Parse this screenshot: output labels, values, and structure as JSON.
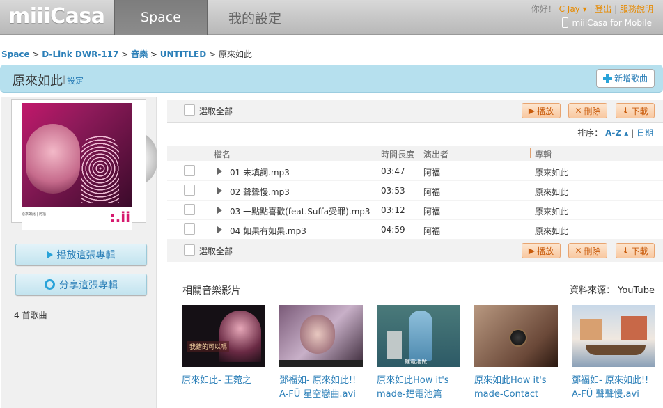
{
  "header": {
    "logo": "miiiCasa",
    "tabs": [
      {
        "label": "Space",
        "active": true
      },
      {
        "label": "我的設定",
        "active": false
      }
    ],
    "greeting": "你好！",
    "user": "C Jay",
    "logout": "登出",
    "help": "服務說明",
    "mobile": "miiiCasa for Mobile"
  },
  "breadcrumb": [
    "Space",
    "D-Link DWR-117",
    "音樂",
    "UNTITLED",
    "原來如此"
  ],
  "album": {
    "title": "原來如此",
    "settings": "設定",
    "new_song": "新增歌曲",
    "play_album": "播放這張專輯",
    "share_album": "分享這張專輯",
    "song_count": "4 首歌曲"
  },
  "toolbar": {
    "select_all": "選取全部",
    "play": "播放",
    "delete": "刪除",
    "download": "下載"
  },
  "sort": {
    "label": "排序：",
    "az": "A-Z",
    "date": "日期"
  },
  "table": {
    "headers": [
      "檔名",
      "時間長度",
      "演出者",
      "專輯"
    ],
    "rows": [
      {
        "file": "01 未填詞.mp3",
        "duration": "03:47",
        "artist": "阿福",
        "album": "原來如此"
      },
      {
        "file": "02 聲聲慢.mp3",
        "duration": "03:53",
        "artist": "阿福",
        "album": "原來如此"
      },
      {
        "file": "03 一點點喜歡(feat.Suffa受罪).mp3",
        "duration": "03:12",
        "artist": "阿福",
        "album": "原來如此"
      },
      {
        "file": "04 如果有如果.mp3",
        "duration": "04:59",
        "artist": "阿福",
        "album": "原來如此"
      }
    ]
  },
  "related": {
    "title": "相關音樂影片",
    "source_label": "資料來源：",
    "source": "YouTube",
    "videos": [
      {
        "line1": "原來如此- 王菀之",
        "line2": "",
        "caption": "我錯的可以嗎"
      },
      {
        "line1": "鄧福如- 原來如此!!",
        "line2": "A-FÜ 星空戀曲.avi",
        "caption": ""
      },
      {
        "line1": "原來如此How it's",
        "line2": "made-鋰電池篇",
        "caption": "鋰電池做"
      },
      {
        "line1": "原來如此How it's",
        "line2": "made-Contact",
        "caption": ""
      },
      {
        "line1": "鄧福如- 原來如此!!",
        "line2": "A-FÜ 聲聲慢.avi",
        "caption": ""
      }
    ]
  },
  "cover": {
    "text": "原來如此 | 阿福"
  }
}
